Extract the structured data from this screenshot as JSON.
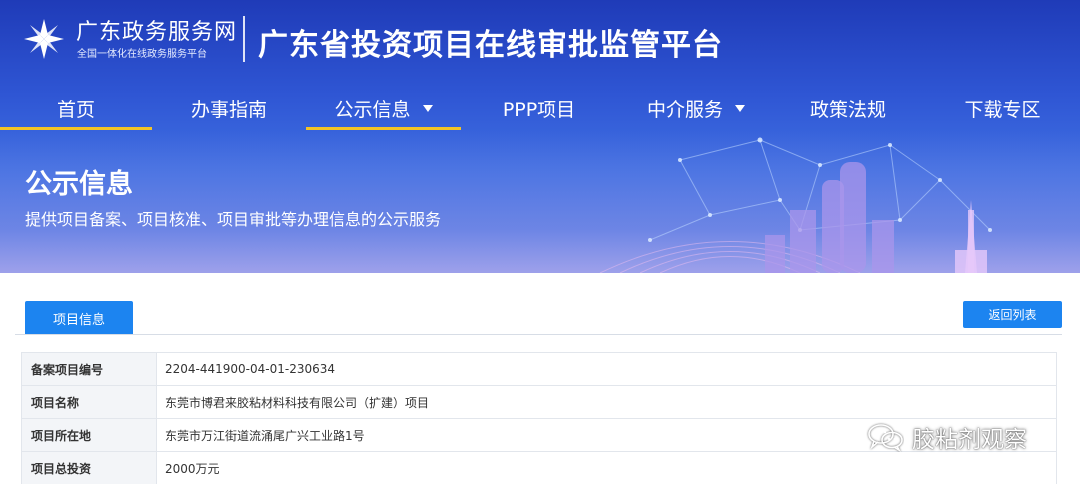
{
  "header": {
    "logo_title": "广东政务服务网",
    "logo_subtitle": "全国一体化在线政务服务平台",
    "platform_title": "广东省投资项目在线审批监管平台"
  },
  "nav": {
    "items": [
      {
        "label": "首页",
        "active": true,
        "dropdown": false
      },
      {
        "label": "办事指南",
        "active": false,
        "dropdown": false
      },
      {
        "label": "公示信息",
        "active": true,
        "dropdown": true
      },
      {
        "label": "PPP项目",
        "active": false,
        "dropdown": false
      },
      {
        "label": "中介服务",
        "active": false,
        "dropdown": true
      },
      {
        "label": "政策法规",
        "active": false,
        "dropdown": false
      },
      {
        "label": "下载专区",
        "active": false,
        "dropdown": false
      }
    ]
  },
  "section": {
    "title": "公示信息",
    "subtitle": "提供项目备案、项目核准、项目审批等办理信息的公示服务"
  },
  "tabs": {
    "project_info": "项目信息"
  },
  "buttons": {
    "back_to_list": "返回列表"
  },
  "table": {
    "rows": [
      {
        "key": "备案项目编号",
        "value": "2204-441900-04-01-230634"
      },
      {
        "key": "项目名称",
        "value": "东莞市博君来胶粘材料科技有限公司（扩建）项目"
      },
      {
        "key": "项目所在地",
        "value": "东莞市万江街道流涌尾广兴工业路1号"
      },
      {
        "key": "项目总投资",
        "value": "2000万元"
      }
    ]
  },
  "watermark": {
    "text": "胶粘剂观察"
  },
  "colors": {
    "banner": "#2f56d4",
    "accent_blue": "#1c84f0",
    "nav_underline": "#f3c425"
  }
}
